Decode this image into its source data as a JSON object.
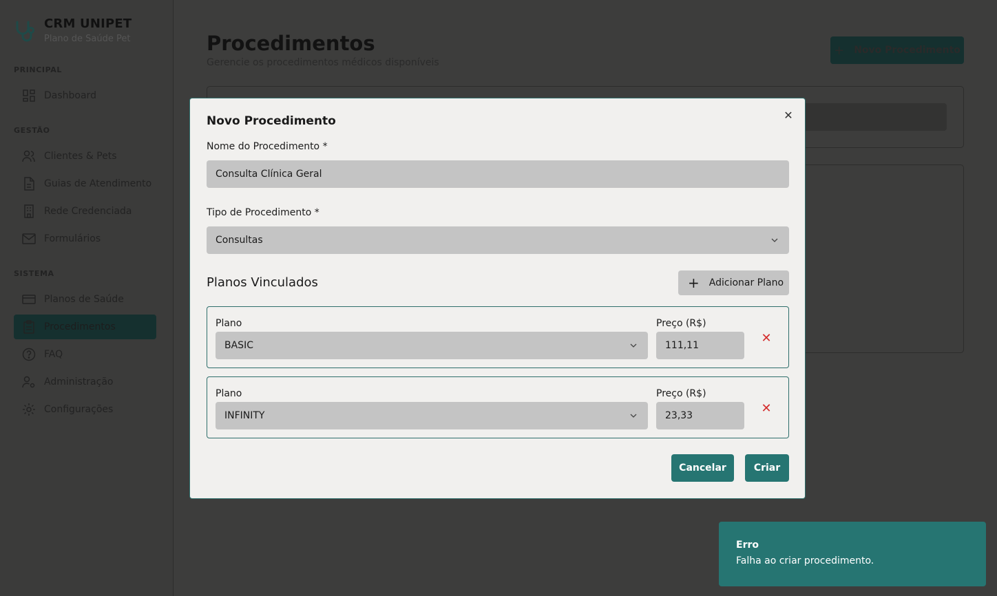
{
  "sidebar": {
    "brand": {
      "title": "CRM UNIPET",
      "subtitle": "Plano de Saúde Pet"
    },
    "sections": [
      {
        "label": "PRINCIPAL"
      },
      {
        "label": "GESTÃO"
      },
      {
        "label": "SISTEMA"
      }
    ],
    "items": [
      {
        "label": "Dashboard",
        "icon": "dashboard-icon"
      },
      {
        "label": "Clientes & Pets",
        "icon": "users-icon"
      },
      {
        "label": "Guias de Atendimento",
        "icon": "document-icon"
      },
      {
        "label": "Rede Credenciada",
        "icon": "building-icon"
      },
      {
        "label": "Formulários",
        "icon": "mail-icon"
      },
      {
        "label": "Planos de Saúde",
        "icon": "credit-card-icon"
      },
      {
        "label": "Procedimentos",
        "icon": "clipboard-icon",
        "active": true
      },
      {
        "label": "FAQ",
        "icon": "help-circle-icon"
      },
      {
        "label": "Administração",
        "icon": "user-cog-icon"
      },
      {
        "label": "Configurações",
        "icon": "settings-icon"
      }
    ]
  },
  "header": {
    "title": "Procedimentos",
    "subtitle": "Gerencie os procedimentos médicos disponíveis",
    "new_button": "Novo Procedimento"
  },
  "modal": {
    "title": "Novo Procedimento",
    "name_label": "Nome do Procedimento *",
    "name_value": "Consulta Clínica Geral",
    "type_label": "Tipo de Procedimento *",
    "type_value": "Consultas",
    "plans_title": "Planos Vinculados",
    "add_plan_label": "Adicionar Plano",
    "plans": [
      {
        "plan_label": "Plano",
        "plan_value": "BASIC",
        "price_label": "Preço (R$)",
        "price_value": "111,11"
      },
      {
        "plan_label": "Plano",
        "plan_value": "INFINITY",
        "price_label": "Preço (R$)",
        "price_value": "23,33"
      }
    ],
    "cancel_label": "Cancelar",
    "create_label": "Criar"
  },
  "toast": {
    "title": "Erro",
    "message": "Falha ao criar procedimento."
  },
  "colors": {
    "accent": "#267572",
    "active_nav": "#15302f",
    "danger": "#d42d2d",
    "modal_bg": "#f1f0ee",
    "overlay_bg": "#3d3d3c"
  }
}
